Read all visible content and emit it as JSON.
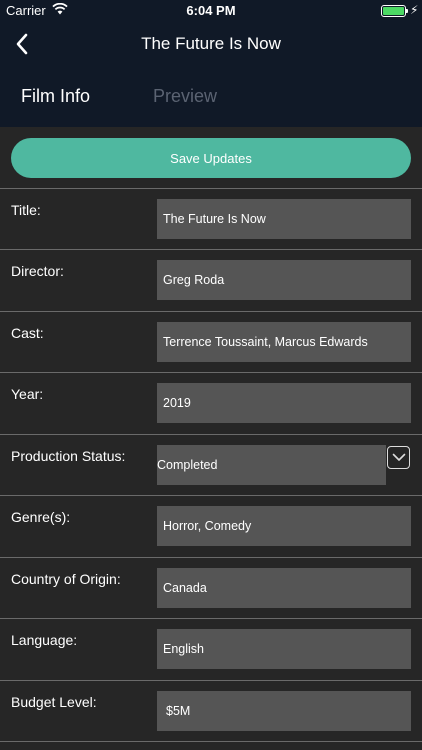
{
  "status_bar": {
    "carrier": "Carrier",
    "time": "6:04 PM",
    "battery_level": 1.0,
    "battery_color": "#4cd964"
  },
  "nav": {
    "title": "The Future Is Now",
    "back_icon": "chevron-left-icon"
  },
  "tabs": [
    {
      "label": "Film Info",
      "active": true
    },
    {
      "label": "Preview",
      "active": false
    }
  ],
  "save_button": {
    "label": "Save Updates",
    "color": "#4fb8a0"
  },
  "fields": [
    {
      "label": "Title:",
      "value": "The Future Is Now"
    },
    {
      "label": "Director:",
      "value": "Greg Roda"
    },
    {
      "label": "Cast:",
      "value": "Terrence Toussaint, Marcus Edwards"
    },
    {
      "label": "Year:",
      "value": "2019"
    },
    {
      "label": "Production Status:",
      "value": "Completed"
    },
    {
      "label": "Genre(s):",
      "value": "Horror, Comedy"
    },
    {
      "label": "Country of Origin:",
      "value": "Canada"
    },
    {
      "label": "Language:",
      "value": "English"
    },
    {
      "label": "Budget Level:",
      "value": "$5M"
    }
  ]
}
